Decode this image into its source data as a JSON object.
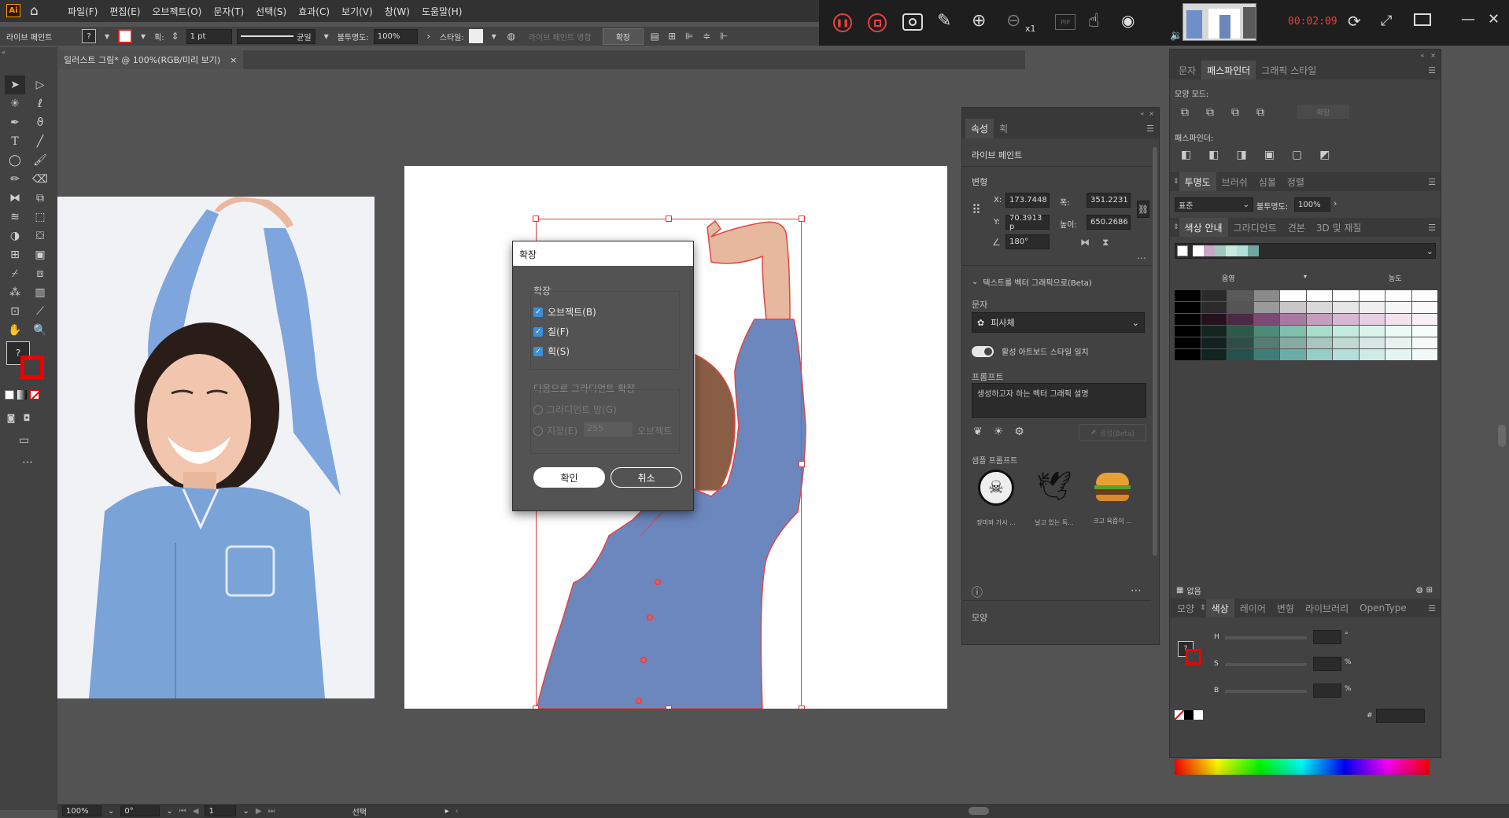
{
  "app": {
    "logo": "Ai"
  },
  "menu": [
    "파일(F)",
    "편집(E)",
    "오브젝트(O)",
    "문자(T)",
    "선택(S)",
    "효과(C)",
    "보기(V)",
    "창(W)",
    "도움말(H)"
  ],
  "recorder": {
    "time": "00:02:09",
    "zoom": "x1",
    "pip": "PIP"
  },
  "control_bar": {
    "mode_label": "라이브 페인트",
    "stroke_weight": "1 pt",
    "stroke_profile": "균일",
    "opacity_label": "불투명도:",
    "opacity_value": "100%",
    "style_label": "스타일:",
    "merge_label": "라이브 페인트 병합",
    "expand_label": "확장"
  },
  "document_tab": {
    "title": "일러스트 그림* @ 100%(RGB/미리 보기)"
  },
  "expand_dialog": {
    "title": "확장",
    "group_label": "확장",
    "options": [
      {
        "label": "오브젝트(B)",
        "checked": true
      },
      {
        "label": "칠(F)",
        "checked": true
      },
      {
        "label": "획(S)",
        "checked": true
      }
    ],
    "gradient_group_label": "다음으로 그라디언트 확장",
    "gradient_mesh_label": "그라디언트 망(G)",
    "specify_label": "지정(E)",
    "specify_value": "255",
    "specify_unit": "오브젝트",
    "ok_label": "확인",
    "cancel_label": "취소"
  },
  "properties_panel": {
    "tabs": [
      "속성",
      "획"
    ],
    "section_title": "라이브 페인트",
    "transform_label": "변형",
    "x_label": "X:",
    "x_value": "173.7448",
    "y_label": "Y:",
    "y_value": "70.3913 p",
    "w_label": "폭:",
    "w_value": "351.2231",
    "h_label": "높이:",
    "h_value": "650.2686",
    "rotation_value": "180°",
    "text_to_vector": "텍스트를 벡터 그래픽으로(Beta)",
    "subject_label": "문자",
    "subject_value": "피사체",
    "active_style_label": "활성 아트보드 스타일 일치",
    "prompt_label": "프롬프트",
    "prompt_placeholder": "생성하고자 하는 벡터 그래픽 설명",
    "generate_label": "생성(Beta)",
    "sample_label": "샘플 프롬프트",
    "samples": [
      "장미와 가시 ...",
      "날고 있는 독...",
      "크고 육즙이 ..."
    ],
    "appearance_label": "모양"
  },
  "pathfinder_panel": {
    "tabs": [
      "문자",
      "패스파인더",
      "그래픽 스타일"
    ],
    "shape_modes_label": "모양 모드:",
    "expand_label": "확장",
    "pathfinders_label": "패스파인더:"
  },
  "transparency_panel": {
    "tabs": [
      "투명도",
      "브러쉬",
      "심볼",
      "정렬"
    ],
    "blend_mode": "표준",
    "opacity_label": "불투명도:",
    "opacity_value": "100%"
  },
  "color_guide_panel": {
    "tabs": [
      "색상 안내",
      "그라디언트",
      "견본",
      "3D 및 재질"
    ],
    "shade_label": "음영",
    "tint_label": "농도",
    "footer_label": "없음",
    "harmony_colors": [
      "#ffffff",
      "#c8a8c8",
      "#a0c8c0",
      "#c8e8e0",
      "#b0e0d8",
      "#6fa8a0"
    ],
    "grid": [
      [
        "#000000",
        "#2a2a2a",
        "#5a5a5a",
        "#8a8a8a",
        "#ffffff",
        "#ffffff",
        "#ffffff",
        "#ffffff",
        "#ffffff",
        "#ffffff"
      ],
      [
        "#000000",
        "#2a2a2a",
        "#555555",
        "#9a9a9a",
        "#c7c7c7",
        "#d9d9d9",
        "#e6e6e6",
        "#efefef",
        "#f6f6f6",
        "#fbfbfb"
      ],
      [
        "#000000",
        "#24121f",
        "#4a2a44",
        "#7b4b73",
        "#a97aa1",
        "#c69cbf",
        "#d7b7d1",
        "#e6cfe1",
        "#f1e2ee",
        "#f8f0f6"
      ],
      [
        "#000000",
        "#12261f",
        "#2c5a4a",
        "#4e8c78",
        "#7fbfab",
        "#a7ddcd",
        "#c4ebdf",
        "#daf4ec",
        "#ecfaf5",
        "#f6fdfb"
      ],
      [
        "#000000",
        "#14221f",
        "#2f4e47",
        "#557b73",
        "#86aaa2",
        "#a8c6bf",
        "#c2d8d3",
        "#d8e7e4",
        "#eaf2f0",
        "#f5f9f8"
      ],
      [
        "#000000",
        "#102422",
        "#24514d",
        "#3f7d77",
        "#6aaea7",
        "#95cec8",
        "#b5dfdb",
        "#cfebe8",
        "#e4f4f2",
        "#f2faf9"
      ]
    ]
  },
  "color_panel": {
    "tabs": [
      "모양",
      "색상",
      "레이어",
      "변형",
      "라이브러리",
      "OpenType"
    ],
    "h_label": "H",
    "s_label": "S",
    "b_label": "B",
    "h_unit": "°",
    "s_unit": "%",
    "b_unit": "%",
    "hex_prefix": "#"
  },
  "status_bar": {
    "zoom": "100%",
    "rotation": "0°",
    "page": "1",
    "mode": "선택"
  }
}
